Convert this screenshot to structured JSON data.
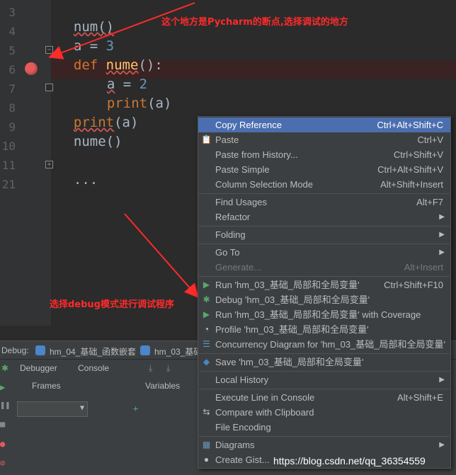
{
  "editor": {
    "line_numbers": [
      "3",
      "4",
      "5",
      "6",
      "7",
      "8",
      "9",
      "10",
      "11",
      "21"
    ],
    "lines": {
      "l3": "num()",
      "l4_a": "a",
      "l4_eq": " = ",
      "l4_val": "3",
      "l5_def": "def",
      "l5_name": "nume",
      "l5_rest": "():",
      "l6_a": "a",
      "l6_eq": " = ",
      "l6_val": "2",
      "l7_print": "print",
      "l7_rest": "(a)",
      "l8_print": "print",
      "l8_rest": "(a)",
      "l9": "nume()",
      "l11": "..."
    }
  },
  "annotations": {
    "top": "这个地方是Pycharm的断点,选择调试的地方",
    "middle": "选择debug模式进行调试程序"
  },
  "debug_bar": {
    "label": "Debug:",
    "tab1": "hm_04_基础_函数嵌套",
    "tab2": "hm_03_基础"
  },
  "debug_tabs": {
    "debugger": "Debugger",
    "console": "Console"
  },
  "panes": {
    "frames": "Frames",
    "variables": "Variables"
  },
  "menu": {
    "items": [
      {
        "label": "Copy Reference",
        "shortcut": "Ctrl+Alt+Shift+C"
      },
      {
        "label": "Paste",
        "shortcut": "Ctrl+V"
      },
      {
        "label": "Paste from History...",
        "shortcut": "Ctrl+Shift+V"
      },
      {
        "label": "Paste Simple",
        "shortcut": "Ctrl+Alt+Shift+V"
      },
      {
        "label": "Column Selection Mode",
        "shortcut": "Alt+Shift+Insert"
      },
      {
        "label": "Find Usages",
        "shortcut": "Alt+F7"
      },
      {
        "label": "Refactor",
        "shortcut": ""
      },
      {
        "label": "Folding",
        "shortcut": ""
      },
      {
        "label": "Go To",
        "shortcut": ""
      },
      {
        "label": "Generate...",
        "shortcut": "Alt+Insert"
      },
      {
        "label": "Run 'hm_03_基础_局部和全局变量'",
        "shortcut": "Ctrl+Shift+F10"
      },
      {
        "label": "Debug 'hm_03_基础_局部和全局变量'",
        "shortcut": ""
      },
      {
        "label": "Run 'hm_03_基础_局部和全局变量' with Coverage",
        "shortcut": ""
      },
      {
        "label": "Profile 'hm_03_基础_局部和全局变量'",
        "shortcut": ""
      },
      {
        "label": "Concurrency Diagram for  'hm_03_基础_局部和全局变量'",
        "shortcut": ""
      },
      {
        "label": "Save 'hm_03_基础_局部和全局变量'",
        "shortcut": ""
      },
      {
        "label": "Local History",
        "shortcut": ""
      },
      {
        "label": "Execute Line in Console",
        "shortcut": "Alt+Shift+E"
      },
      {
        "label": "Compare with Clipboard",
        "shortcut": ""
      },
      {
        "label": "File Encoding",
        "shortcut": ""
      },
      {
        "label": "Diagrams",
        "shortcut": ""
      },
      {
        "label": "Create Gist...",
        "shortcut": ""
      }
    ]
  },
  "watermark": "https://blog.csdn.net/qq_36354559",
  "colors": {
    "breakpoint": "#e55b5b",
    "menu_selection": "#4b6eaf",
    "annotation": "#ff2a2a"
  }
}
